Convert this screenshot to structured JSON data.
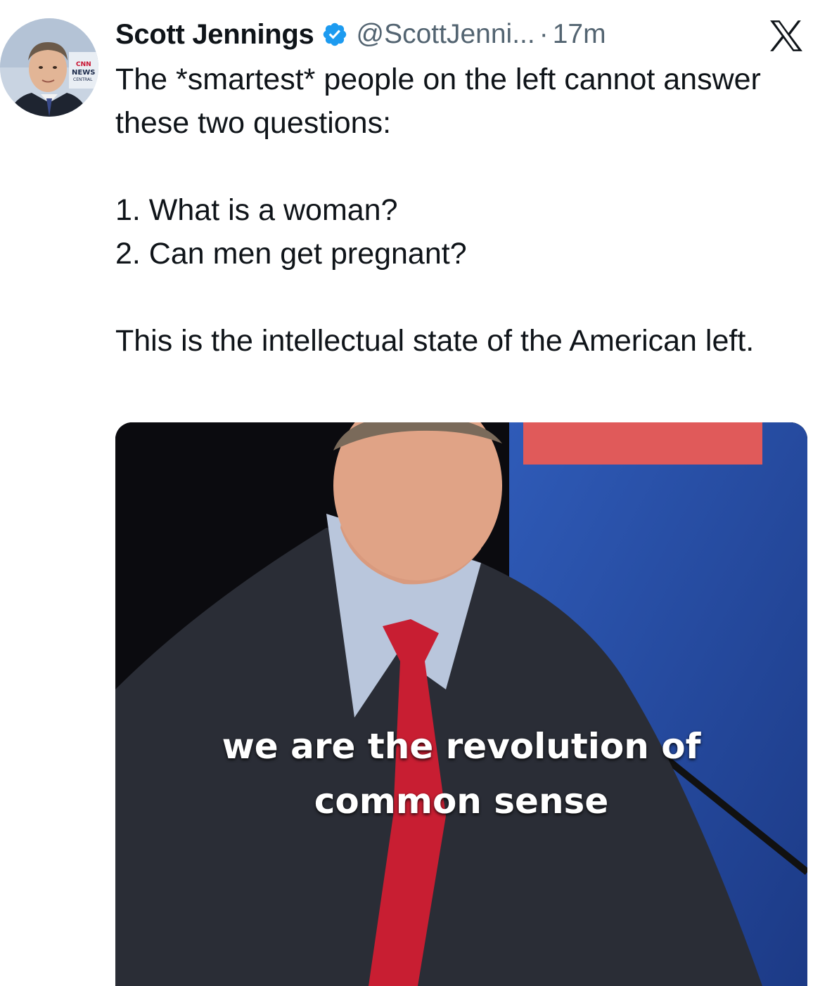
{
  "tweet": {
    "author": {
      "display_name": "Scott Jennings",
      "handle": "@ScottJenni...",
      "verified": true,
      "verified_icon": "verified-badge-icon",
      "avatar_badge_text": [
        "CNN",
        "NEWS",
        "CENTRAL"
      ]
    },
    "separator": "·",
    "time": "17m",
    "platform_icon": "x-logo-icon",
    "body": {
      "line1": "The *smartest* people on the left cannot answer these two questions:",
      "item1": "1. What is a woman?",
      "item2": "2. Can men get pregnant?",
      "line2": "This is the intellectual state of the American left."
    },
    "media": {
      "caption_line1": "we are the revolution of",
      "caption_line2": "common sense"
    }
  },
  "colors": {
    "verified_blue": "#1d9bf0",
    "secondary_text": "#536471",
    "primary_text": "#0f1419"
  }
}
